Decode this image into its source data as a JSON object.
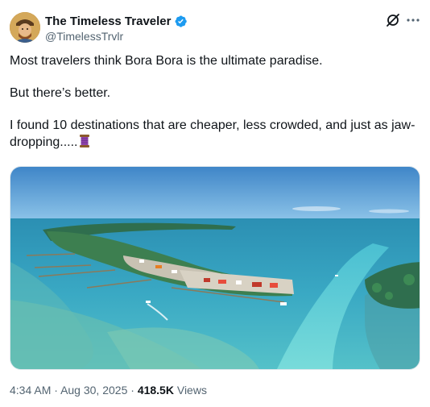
{
  "author": {
    "name": "The Timeless Traveler",
    "handle": "@TimelessTrvlr",
    "verified": true,
    "badge_color": "#1d9bf0"
  },
  "tweet": {
    "paragraphs": [
      "Most travelers think Bora Bora is the ultimate paradise.",
      "But there’s better.",
      "I found 10 destinations that are cheaper, less crowded, and just as jaw-dropping....."
    ],
    "trailing_emoji": "spool-of-thread-emoji"
  },
  "media": {
    "description_icon": "aerial-island-photo"
  },
  "meta": {
    "time": "4:34 AM",
    "separator": "·",
    "date": "Aug 30, 2025",
    "views_count": "418.5K",
    "views_label": "Views"
  },
  "colors": {
    "text_primary": "#0f1419",
    "text_secondary": "#536471",
    "verified_blue": "#1d9bf0"
  }
}
